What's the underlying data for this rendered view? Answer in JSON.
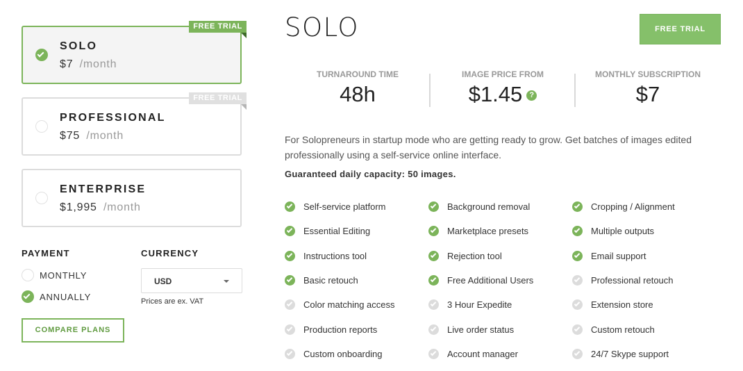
{
  "plans": [
    {
      "name": "SOLO",
      "price": "$7",
      "per": "/month",
      "ribbon": "FREE TRIAL",
      "selected": true
    },
    {
      "name": "PROFESSIONAL",
      "price": "$75",
      "per": "/month",
      "ribbon": "FREE TRIAL",
      "selected": false
    },
    {
      "name": "ENTERPRISE",
      "price": "$1,995",
      "per": "/month",
      "ribbon": "",
      "selected": false
    }
  ],
  "payment": {
    "label": "PAYMENT",
    "options": [
      {
        "label": "MONTHLY",
        "selected": false
      },
      {
        "label": "ANNUALLY",
        "selected": true
      }
    ]
  },
  "currency": {
    "label": "CURRENCY",
    "value": "USD",
    "note": "Prices are ex. VAT"
  },
  "compare_label": "COMPARE PLANS",
  "detail": {
    "title": "SOLO",
    "trial_label": "FREE TRIAL",
    "stats": [
      {
        "label": "TURNAROUND TIME",
        "value": "48h"
      },
      {
        "label": "IMAGE PRICE FROM",
        "value": "$1.45"
      },
      {
        "label": "MONTHLY SUBSCRIPTION",
        "value": "$7"
      }
    ],
    "help_glyph": "?",
    "description": "For Solopreneurs in startup mode who are getting ready to grow. Get batches of images edited professionally using a self-service online interface.",
    "capacity": "Guaranteed daily capacity: 50 images."
  },
  "features": [
    [
      {
        "label": "Self-service platform",
        "included": true
      },
      {
        "label": "Essential Editing",
        "included": true
      },
      {
        "label": "Instructions tool",
        "included": true
      },
      {
        "label": "Basic retouch",
        "included": true
      },
      {
        "label": "Color matching access",
        "included": false
      },
      {
        "label": "Production reports",
        "included": false
      },
      {
        "label": "Custom onboarding",
        "included": false
      }
    ],
    [
      {
        "label": "Background removal",
        "included": true
      },
      {
        "label": "Marketplace presets",
        "included": true
      },
      {
        "label": "Rejection tool",
        "included": true
      },
      {
        "label": "Free Additional Users",
        "included": true
      },
      {
        "label": "3 Hour Expedite",
        "included": false
      },
      {
        "label": "Live order status",
        "included": false
      },
      {
        "label": "Account manager",
        "included": false
      }
    ],
    [
      {
        "label": "Cropping / Alignment",
        "included": true
      },
      {
        "label": "Multiple outputs",
        "included": true
      },
      {
        "label": "Email support",
        "included": true
      },
      {
        "label": "Professional retouch",
        "included": false
      },
      {
        "label": "Extension store",
        "included": false
      },
      {
        "label": "Custom retouch",
        "included": false
      },
      {
        "label": "24/7 Skype support",
        "included": false
      }
    ]
  ],
  "colors": {
    "accent": "#7cb45a",
    "muted": "#dcdcdc"
  }
}
